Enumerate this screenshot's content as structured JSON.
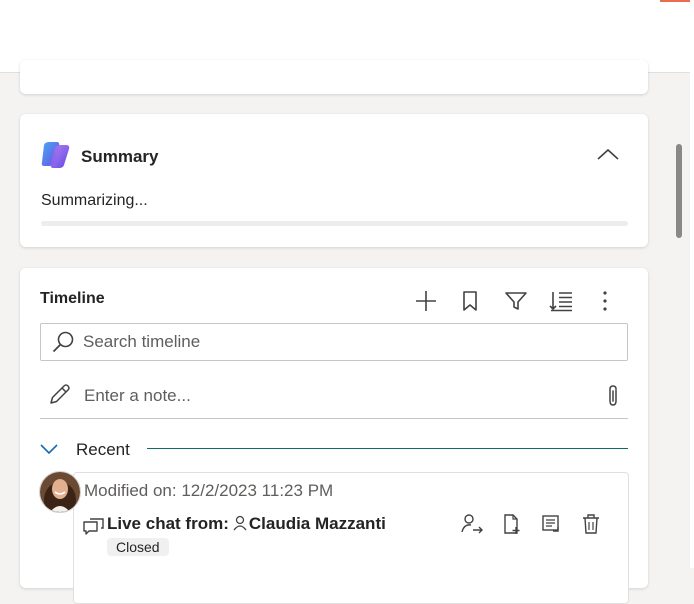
{
  "colors": {
    "accent": "#ea6b4d",
    "recent_divider": "#0f6b6b",
    "card": "#ffffff",
    "page_background": "#f4f3f2"
  },
  "summary": {
    "title": "Summary",
    "status": "Summarizing...",
    "progress_percent": 0,
    "icon": "copilot-icon",
    "collapse_icon": "chevron-up-icon"
  },
  "timeline": {
    "title": "Timeline",
    "toolbar": [
      "add-icon",
      "bookmark-icon",
      "filter-icon",
      "sort-icon",
      "more-options-icon"
    ],
    "search": {
      "placeholder": "Search timeline",
      "value": ""
    },
    "note": {
      "placeholder": "Enter a note...",
      "value": ""
    },
    "section": {
      "label": "Recent",
      "expanded": true
    },
    "activity": {
      "modified": "Modified on: 12/2/2023 11:23 PM",
      "title_prefix": "Live chat from:",
      "contact": "Claudia Mazzanti",
      "status": "Closed",
      "actions": [
        "assign-icon",
        "add-to-queue-icon",
        "open-record-icon",
        "delete-icon"
      ]
    }
  }
}
